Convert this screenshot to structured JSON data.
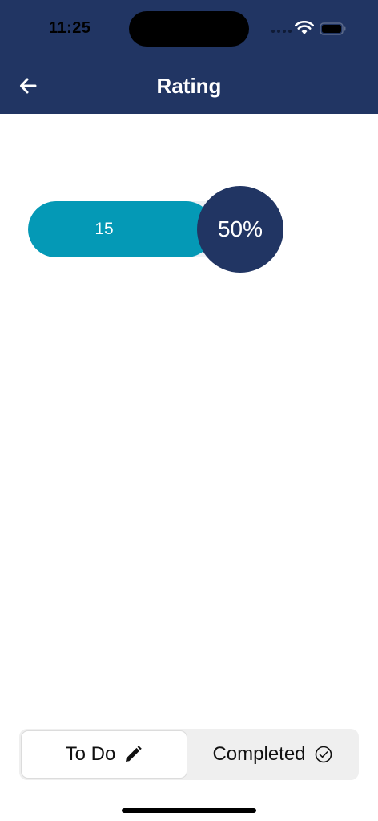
{
  "status_bar": {
    "time": "11:25",
    "icons": [
      "signal-dots-icon",
      "wifi-icon",
      "battery-icon"
    ]
  },
  "header": {
    "title": "Rating",
    "back_icon": "arrow-left-icon"
  },
  "rating": {
    "value": "15",
    "percent_label": "50%",
    "percent": 50
  },
  "tabs": {
    "todo": {
      "label": "To Do",
      "icon": "pencil-icon",
      "selected": true
    },
    "completed": {
      "label": "Completed",
      "icon": "check-circle-icon",
      "selected": false
    }
  },
  "colors": {
    "header": "#213563",
    "accent": "#0499b6",
    "circle": "#213563"
  }
}
